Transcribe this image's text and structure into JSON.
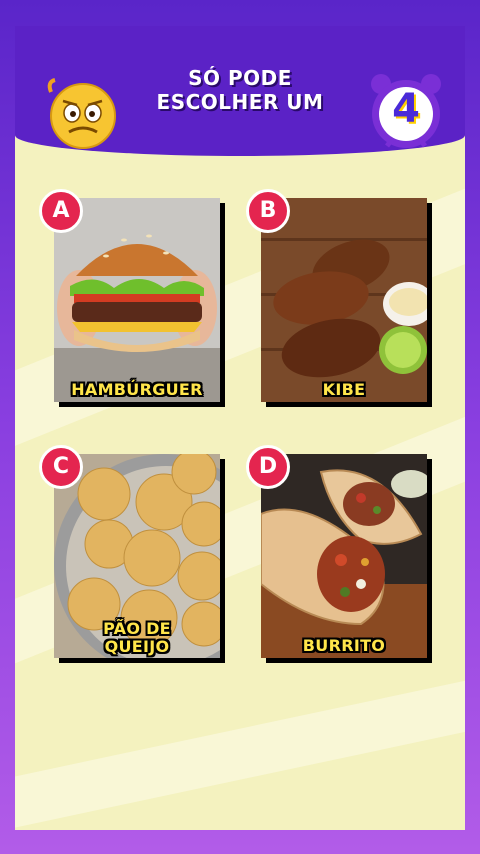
{
  "header": {
    "title_line1": "SÓ PODE",
    "title_line2": "ESCOLHER UM",
    "countdown": "4",
    "emoji_icon": "worried-face-emoji-icon",
    "timer_icon": "alarm-clock-icon"
  },
  "options": [
    {
      "letter": "A",
      "label": "HAMBÚRGUER",
      "image": "hamburger-photo"
    },
    {
      "letter": "B",
      "label": "KIBE",
      "image": "kibe-photo"
    },
    {
      "letter": "C",
      "label_line1": "PÃO DE",
      "label_line2": "QUEIJO",
      "image": "pao-de-queijo-photo"
    },
    {
      "letter": "D",
      "label": "BURRITO",
      "image": "burrito-photo"
    }
  ],
  "colors": {
    "header": "#5b22c6",
    "background": "#f4f2bf",
    "badge": "#e4254f",
    "label": "#ffe54a"
  }
}
